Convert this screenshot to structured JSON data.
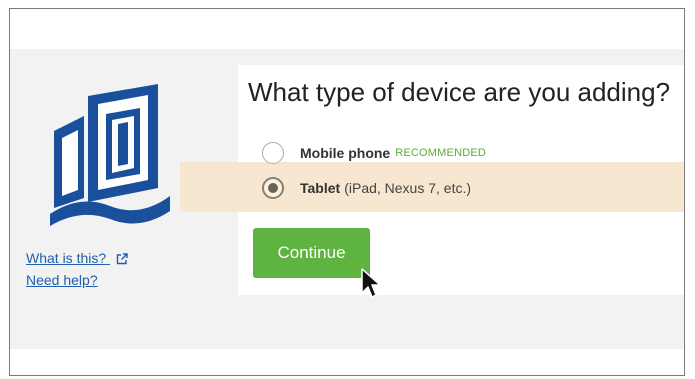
{
  "heading": "What type of device are you adding?",
  "options": [
    {
      "label": "Mobile phone",
      "badge": "RECOMMENDED",
      "desc": "",
      "selected": false
    },
    {
      "label": "Tablet",
      "badge": "",
      "desc": "(iPad, Nexus 7, etc.)",
      "selected": true
    }
  ],
  "continue_label": "Continue",
  "links": {
    "what_is_this": "What is this?",
    "need_help": "Need help?"
  },
  "colors": {
    "button": "#5fb441",
    "recommended": "#5aab3a",
    "highlight": "#f7e7d0",
    "logo": "#1a4f9c",
    "link": "#1f5fb0"
  },
  "icons": [
    "external-link-icon",
    "mouse-cursor-icon",
    "book-logo"
  ]
}
